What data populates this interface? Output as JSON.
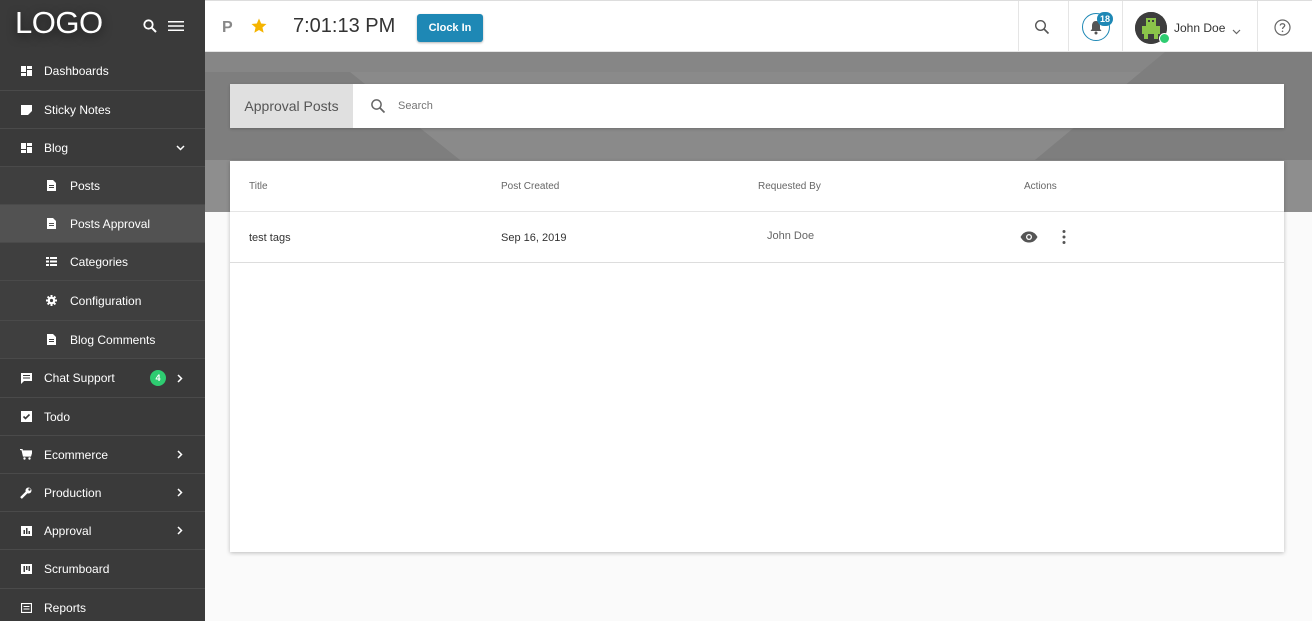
{
  "app": {
    "logo": "LOGO"
  },
  "sidebar": {
    "items": [
      {
        "label": "Dashboards",
        "icon": "dashboard-icon"
      },
      {
        "label": "Sticky Notes",
        "icon": "note-icon"
      },
      {
        "label": "Blog",
        "icon": "dashboard-icon",
        "expanded": true
      },
      {
        "label": "Posts",
        "icon": "document-icon",
        "sub": true
      },
      {
        "label": "Posts Approval",
        "icon": "document-icon",
        "sub": true,
        "active": true
      },
      {
        "label": "Categories",
        "icon": "list-icon",
        "sub": true
      },
      {
        "label": "Configuration",
        "icon": "gear-icon",
        "sub": true
      },
      {
        "label": "Blog Comments",
        "icon": "document-icon",
        "sub": true
      },
      {
        "label": "Chat Support",
        "icon": "chat-icon",
        "badge": "4"
      },
      {
        "label": "Todo",
        "icon": "checkbox-icon"
      },
      {
        "label": "Ecommerce",
        "icon": "cart-icon"
      },
      {
        "label": "Production",
        "icon": "wrench-icon"
      },
      {
        "label": "Approval",
        "icon": "chart-icon"
      },
      {
        "label": "Scrumboard",
        "icon": "board-icon"
      },
      {
        "label": "Reports",
        "icon": "report-icon"
      }
    ]
  },
  "topbar": {
    "project_initial": "P",
    "time": "7:01:13 PM",
    "clock_in_label": "Clock In",
    "notification_count": "18",
    "user_name": "John Doe",
    "accent_color": "#1e88b5"
  },
  "search_panel": {
    "title": "Approval Posts",
    "placeholder": "Search"
  },
  "table": {
    "columns": [
      "Title",
      "Post Created",
      "Requested By",
      "Actions"
    ],
    "rows": [
      {
        "title": "test tags",
        "post_created": "Sep 16, 2019",
        "requested_by": "John Doe"
      }
    ]
  }
}
